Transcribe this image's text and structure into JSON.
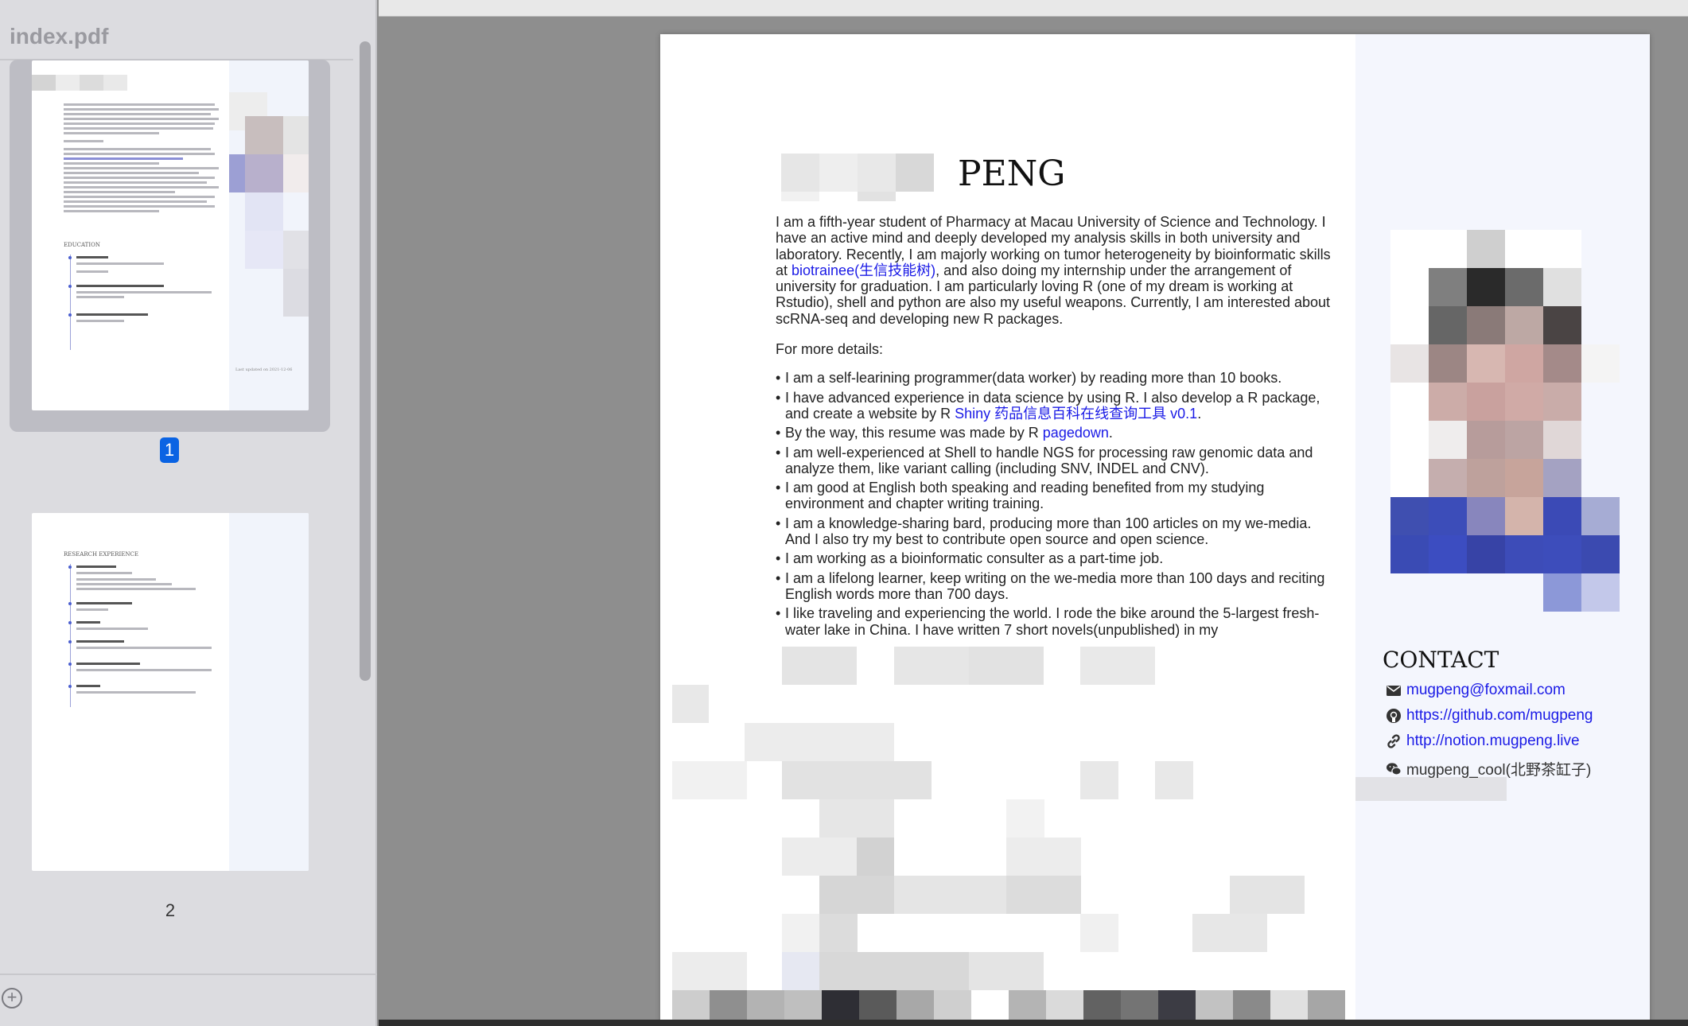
{
  "sidebar": {
    "title": "index.pdf",
    "pages": [
      {
        "label": "1",
        "selected": true
      },
      {
        "label": "2",
        "selected": false
      }
    ],
    "thumb1": {
      "section_education": "EDUCATION",
      "last_updated": "Last updated on 2021-12-06"
    },
    "thumb2": {
      "section_research": "RESEARCH EXPERIENCE"
    },
    "add_icon": "plus-circle-icon"
  },
  "resume": {
    "surname": "PENG",
    "intro_pre": "I am a fifth-year student of Pharmacy at Macau University of Science and Technology. I have an active mind and deeply developed my analysis skills in both university and laboratory. Recently, I am majorly working on tumor heterogeneity by bioinformatic skills at ",
    "intro_link": "biotrainee(生信技能树)",
    "intro_post": ", and also doing my internship under the arrangement of university for graduation. I am particularly loving R (one of my dream is working at Rstudio), shell and python are also my useful weapons. Currently, I am interested about scRNA-seq and developing new R packages.",
    "more_details": "For more details:",
    "details": {
      "d1": "I am a self-learining programmer(data worker) by reading more than 10 books.",
      "d2_pre": "I have advanced experience in data science by using R. I also develop a R package, and create a website by R ",
      "d2_link": "Shiny 药品信息百科在线查询工具 v0.1",
      "d2_post": ".",
      "d3_pre": "By the way, this resume was made by R ",
      "d3_link": "pagedown",
      "d3_post": ".",
      "d4": "I am well-experienced at Shell to handle NGS for processing raw genomic data and analyze them, like variant calling (including SNV, INDEL and CNV).",
      "d5": "I am good at English both speaking and reading benefited from my studying environment and chapter writing training.",
      "d6": "I am a knowledge-sharing bard, producing more than 100 articles on my we-media. And I also try my best to contribute open source and open science.",
      "d7": "I am working as a bioinformatic consulter as a part-time job.",
      "d8": "I am a lifelong learner, keep writing on the we-media more than 100 days and reciting English words more than 700 days.",
      "d9": "I like traveling and experiencing the world. I rode the bike around the 5-largest fresh-water lake in China. I have written 7 short novels(unpublished) in my"
    },
    "contact": {
      "heading": "CONTACT",
      "email": "mugpeng@foxmail.com",
      "github": "https://github.com/mugpeng",
      "website": "http://notion.mugpeng.live",
      "wechat": "mugpeng_cool(北野茶缸子)"
    }
  }
}
